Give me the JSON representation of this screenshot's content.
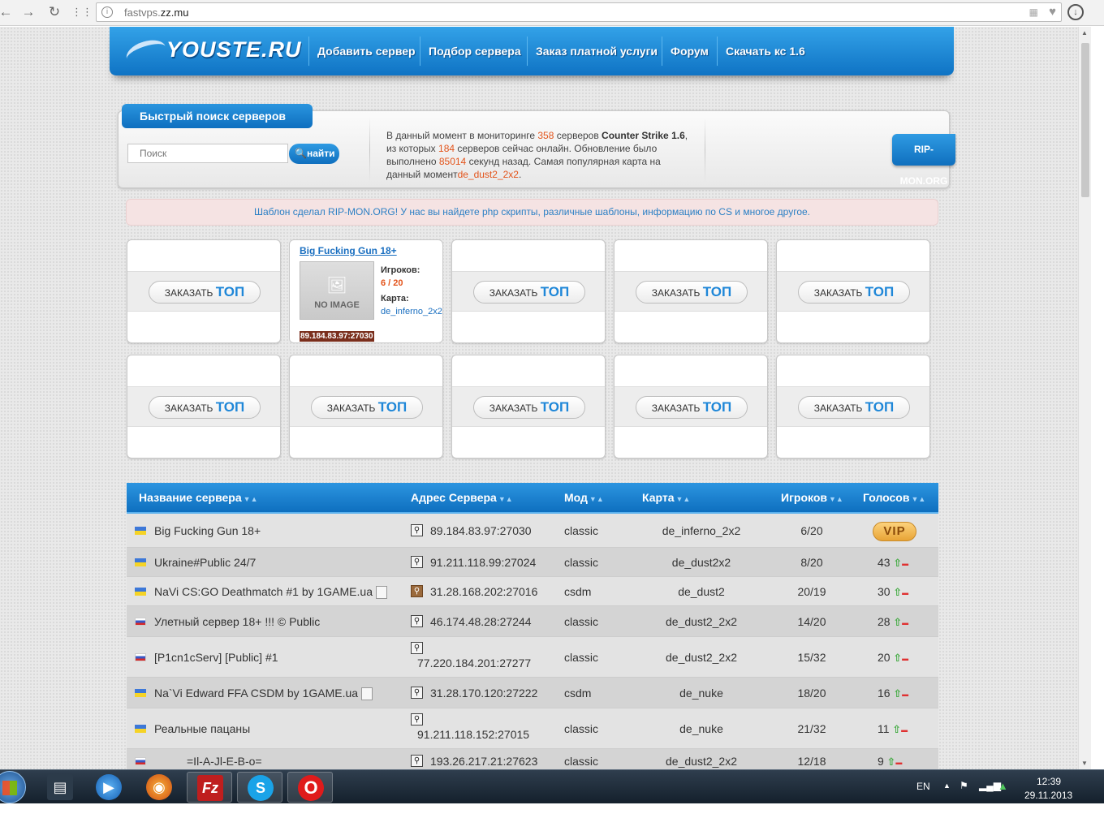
{
  "browser": {
    "url_prefix": "fastvps.",
    "url_domain": "zz.mu"
  },
  "header": {
    "logo_text": "YOUSTE.RU",
    "menu": [
      "Добавить сервер",
      "Подбор сервера",
      "Заказ платной услуги",
      "Форум",
      "Скачать кс 1.6"
    ]
  },
  "search": {
    "title": "Быстрый поиск серверов",
    "placeholder": "Поиск",
    "button": "найти"
  },
  "stats": {
    "p1": "В данный момент в мониторинге ",
    "servers_total": "358",
    "p2": " серверов ",
    "game": "Counter Strike 1.6",
    "p3": ", из которых ",
    "servers_online": "184",
    "p4": " серверов сейчас онлайн. Обновление было выполнено ",
    "seconds": "85014",
    "p5": " секунд назад. Самая популярная карта на данный момент",
    "popular_map": "de_dust2_2x2",
    "p6": "."
  },
  "ripmon_label": "RIP-MON.ORG",
  "notice": "Шаблон сделал RIP-MON.ORG! У нас вы найдете php скрипты, различные шаблоны, информацию по CS и многое другое.",
  "top_slots": {
    "order_prefix": "ЗАКАЗАТЬ",
    "order_top": "ТОП",
    "featured": {
      "name": "Big Fucking Gun 18+",
      "noimage": "NO IMAGE",
      "players_label": "Игроков:",
      "players": "6 / 20",
      "map_label": "Карта:",
      "map": "de_inferno_2x2",
      "ip": "89.184.83.97:27030"
    }
  },
  "table": {
    "headers": [
      "Название сервера",
      "Адрес Сервера",
      "Мод",
      "Карта",
      "Игроков",
      "Голосов"
    ],
    "vip_label": "VIP",
    "rows": [
      {
        "flag": "ua",
        "name": "Big Fucking Gun 18+",
        "address": "89.184.83.97:27030",
        "mod": "classic",
        "map": "de_inferno_2x2",
        "players": "6/20",
        "votes": "VIP"
      },
      {
        "flag": "ua",
        "name": "Ukraine#Public 24/7",
        "address": "91.211.118.99:27024",
        "mod": "classic",
        "map": "de_dust2x2",
        "players": "8/20",
        "votes": "43"
      },
      {
        "flag": "ua",
        "name": "NaVi CS:GO Deathmatch #1 by 1GAME.ua",
        "address": "31.28.168.202:27016",
        "mod": "csdm",
        "map": "de_dust2",
        "players": "20/19",
        "votes": "30"
      },
      {
        "flag": "ru",
        "name": "Улетный сервер 18+ !!! © Public",
        "address": "46.174.48.28:27244",
        "mod": "classic",
        "map": "de_dust2_2x2",
        "players": "14/20",
        "votes": "28"
      },
      {
        "flag": "ru",
        "name": "[P1cn1cServ] [Public] #1",
        "address": "77.220.184.201:27277",
        "mod": "classic",
        "map": "de_dust2_2x2",
        "players": "15/32",
        "votes": "20"
      },
      {
        "flag": "ua",
        "name": "Na`Vi Edward FFA CSDM by 1GAME.ua",
        "address": "31.28.170.120:27222",
        "mod": "csdm",
        "map": "de_nuke",
        "players": "18/20",
        "votes": "16"
      },
      {
        "flag": "ua",
        "name": "Реальные пацаны",
        "address": "91.211.118.152:27015",
        "mod": "classic",
        "map": "de_nuke",
        "players": "21/32",
        "votes": "11"
      },
      {
        "flag": "ru",
        "name": "=Il-A-Jl-E-B-o=",
        "address": "193.26.217.21:27623",
        "mod": "classic",
        "map": "de_dust2_2x2",
        "players": "12/18",
        "votes": "9"
      }
    ]
  },
  "taskbar": {
    "lang": "EN",
    "time": "12:39",
    "date": "29.11.2013"
  }
}
